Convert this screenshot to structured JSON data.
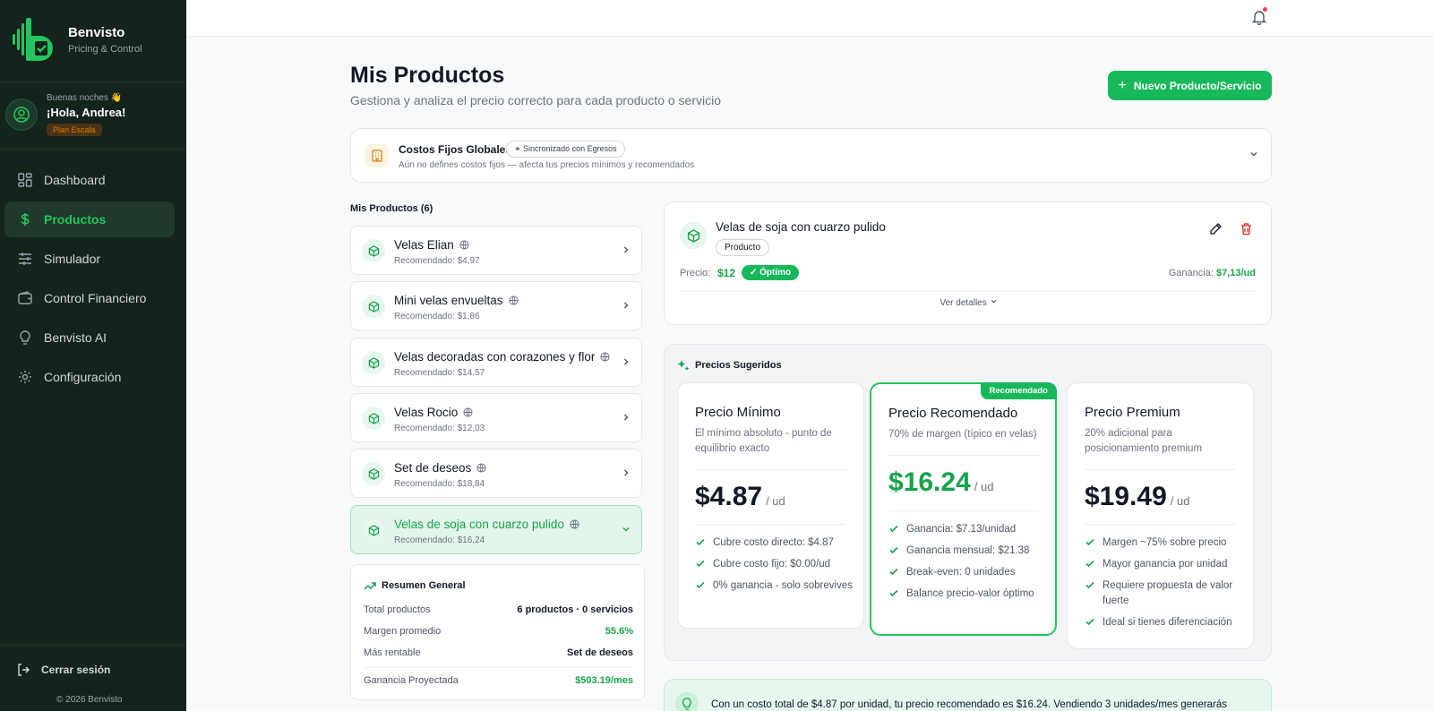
{
  "brand": {
    "name": "Benvisto",
    "subtitle": "Pricing & Control"
  },
  "user": {
    "greeting_small": "Buenas noches 👋",
    "greeting": "¡Hola, Andrea!",
    "plan": "Plan Escala"
  },
  "nav": [
    {
      "label": "Dashboard",
      "icon": "dashboard-icon",
      "active": false
    },
    {
      "label": "Productos",
      "icon": "dollar-icon",
      "active": true
    },
    {
      "label": "Simulador",
      "icon": "sliders-icon",
      "active": false
    },
    {
      "label": "Control Financiero",
      "icon": "wallet-icon",
      "active": false
    },
    {
      "label": "Benvisto AI",
      "icon": "lightbulb-icon",
      "active": false
    },
    {
      "label": "Configuración",
      "icon": "gear-icon",
      "active": false
    }
  ],
  "logout": "Cerrar sesión",
  "copyright": "© 2026 Benvisto",
  "header": {
    "title": "Mis Productos",
    "subtitle": "Gestiona y analiza el precio correcto para cada producto o servicio",
    "new_button": "Nuevo Producto/Servicio"
  },
  "costos": {
    "title": "Costos Fijos Globales",
    "badge": "Sincronizado con Egresos",
    "subtitle": "Aún no defines costos fijos — afecta tus precios mínimos y recomendados"
  },
  "list": {
    "title": "Mis Productos (6)",
    "items": [
      {
        "name": "Velas Elian",
        "rec": "Recomendado: $4,97"
      },
      {
        "name": "Mini velas envueltas",
        "rec": "Recomendado: $1,86"
      },
      {
        "name": "Velas decoradas con corazones y flor",
        "rec": "Recomendado: $14,57"
      },
      {
        "name": "Velas Rocio",
        "rec": "Recomendado: $12,03"
      },
      {
        "name": "Set de deseos",
        "rec": "Recomendado: $18,84"
      },
      {
        "name": "Velas de soja con cuarzo pulido",
        "rec": "Recomendado: $16,24"
      }
    ]
  },
  "resumen": {
    "title": "Resumen General",
    "total_label": "Total productos",
    "total_value": "6 productos · 0 servicios",
    "margen_label": "Margen promedio",
    "margen_value": "55.6%",
    "rentable_label": "Más rentable",
    "rentable_value": "Set de deseos",
    "ganancia_label": "Ganancia Proyectada",
    "ganancia_value": "$503.19/mes"
  },
  "detail": {
    "name": "Velas de soja con cuarzo pulido",
    "type": "Producto",
    "price_label": "Precio:",
    "price": "$12",
    "status": "✓ Óptimo",
    "gain_label": "Ganancia:",
    "gain_value": "$7,13/ud",
    "more": "Ver detalles"
  },
  "sugeridos": {
    "title": "Precios Sugeridos",
    "recommended_badge": "Recomendado",
    "cards": [
      {
        "title": "Precio Mínimo",
        "desc": "El mínimo absoluto - punto de equilibrio exacto",
        "price": "$4.87",
        "unit": "/ ud",
        "features": [
          "Cubre costo directo: $4.87",
          "Cubre costo fijo: $0.00/ud",
          "0% ganancia - solo sobrevives"
        ]
      },
      {
        "title": "Precio Recomendado",
        "desc": "70% de margen (típico en velas)",
        "price": "$16.24",
        "unit": "/ ud",
        "features": [
          "Ganancia: $7.13/unidad",
          "Ganancia mensual: $21.38",
          "Break-even: 0 unidades",
          "Balance precio-valor óptimo"
        ]
      },
      {
        "title": "Precio Premium",
        "desc": "20% adicional para posicionamiento premium",
        "price": "$19.49",
        "unit": "/ ud",
        "features": [
          "Margen ~75% sobre precio",
          "Mayor ganancia por unidad",
          "Requiere propuesta de valor fuerte",
          "Ideal si tienes diferenciación"
        ]
      }
    ]
  },
  "tip": "Con un costo total de $4.87 por unidad, tu precio recomendado es $16.24. Vendiendo 3 unidades/mes generarás",
  "colors": {
    "brand_green": "#16b85a",
    "sidebar_bg": "#14231c",
    "alert_red": "#ef4444"
  }
}
